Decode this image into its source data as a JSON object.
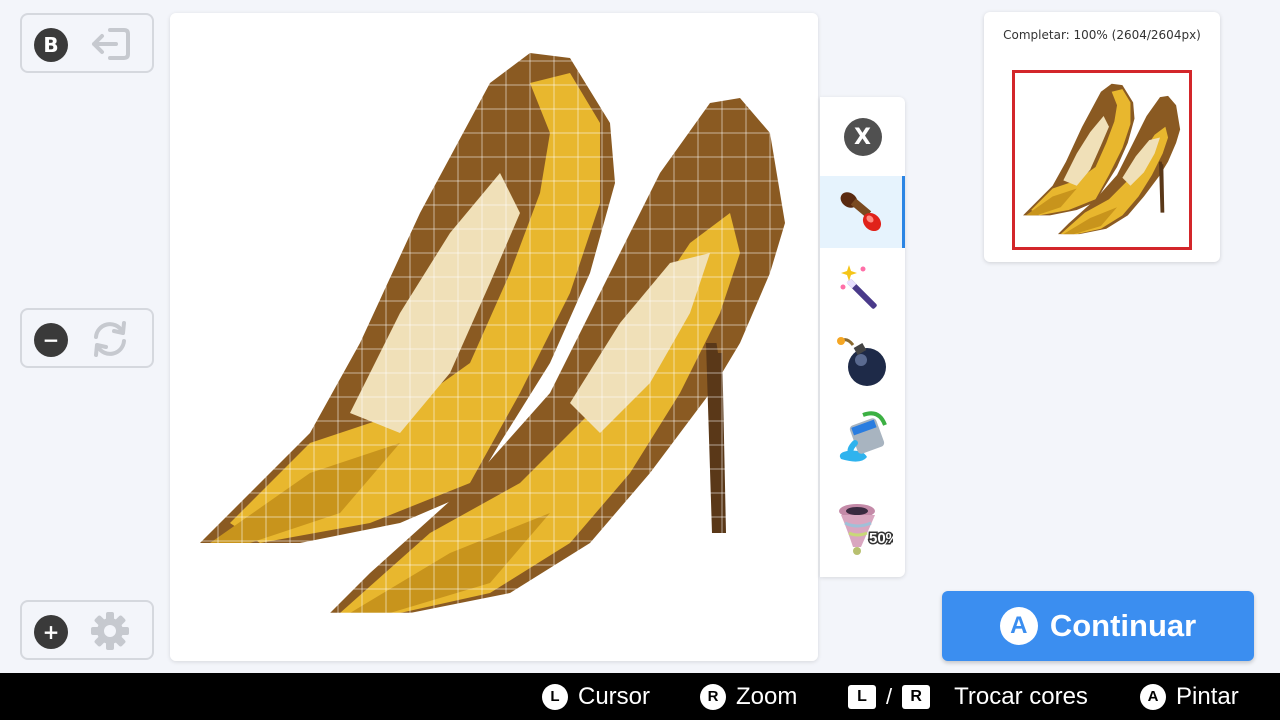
{
  "side_buttons": {
    "back": {
      "glyph": "B",
      "icon": "exit-icon"
    },
    "reset": {
      "glyph": "−",
      "icon": "refresh-icon"
    },
    "settings": {
      "glyph": "+",
      "icon": "gear-icon"
    }
  },
  "tools": [
    {
      "icon": "close-icon",
      "label": "X"
    },
    {
      "icon": "paintbrush-icon",
      "selected": true
    },
    {
      "icon": "magic-wand-icon"
    },
    {
      "icon": "bomb-icon"
    },
    {
      "icon": "paint-bucket-icon"
    },
    {
      "icon": "tornado-icon",
      "badge": "50%"
    }
  ],
  "preview": {
    "progress_text": "Completar: 100% (2604/2604px)",
    "progress": 1.0
  },
  "continue_button": {
    "glyph": "A",
    "label": "Continuar"
  },
  "footer": {
    "cursor": {
      "glyph": "L",
      "label": "Cursor"
    },
    "zoom": {
      "glyph": "R",
      "label": "Zoom"
    },
    "swap": {
      "glyph_left": "L",
      "separator": "/",
      "glyph_right": "R",
      "label": "Trocar cores"
    },
    "paint": {
      "glyph": "A",
      "label": "Pintar"
    }
  },
  "colors": {
    "accent": "#3b8ef0",
    "gold": "#e8b72e",
    "gold_dark": "#c8941c",
    "brown": "#8a5a22",
    "brown_dark": "#5a3818",
    "cream": "#f0e0b8",
    "frame_red": "#d3262a"
  }
}
